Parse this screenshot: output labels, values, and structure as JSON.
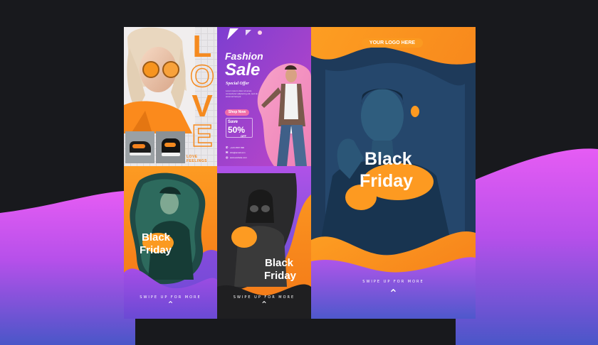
{
  "colors": {
    "background_dark": "#18191d",
    "wave_top": "#e056f0",
    "wave_bottom": "#4c55ca",
    "orange": "#fb8e1d",
    "purple": "#8a3fd6",
    "navy": "#1f2d4a"
  },
  "love_post": {
    "letters": [
      "L",
      "O",
      "V",
      "E"
    ],
    "tagline": "LOVE FEELINGS"
  },
  "fashion_post": {
    "title_line1": "Fashion",
    "title_line2": "Sale",
    "subtitle": "Special Offer",
    "body": "Lorem ipsum dolor sit amet, consectetur adipiscing elit, sed do eiusmod tempor.",
    "cta": "Shop Now",
    "save_label": "Save",
    "discount": "50%",
    "off_label": "OFF",
    "phone": "+123 4567 890",
    "email": "info@email.com",
    "web": "www.website.com"
  },
  "story_small_1": {
    "line1": "Black",
    "line2": "Friday",
    "swipe": "SWIPE UP FOR MORE"
  },
  "story_small_2": {
    "line1": "Black",
    "line2": "Friday",
    "swipe": "SWIPE UP FOR MORE"
  },
  "story_large": {
    "logo": "YOUR LOGO HERE",
    "line1": "Black",
    "line2": "Friday",
    "swipe": "SWIPE UP FOR MORE"
  },
  "icons": {
    "chevron": "chevron-up-icon",
    "phone": "phone-icon",
    "email": "mail-icon",
    "web": "globe-icon"
  }
}
